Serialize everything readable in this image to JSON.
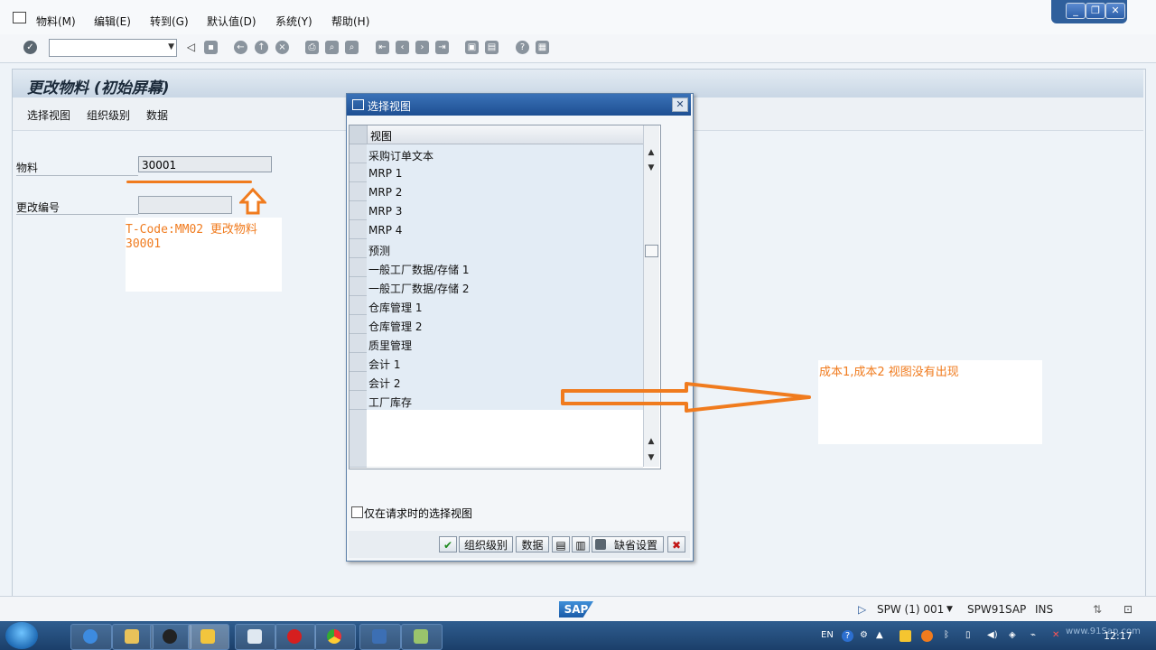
{
  "menu": {
    "items": [
      "物料(M)",
      "编辑(E)",
      "转到(G)",
      "默认值(D)",
      "系统(Y)",
      "帮助(H)"
    ]
  },
  "window_controls": {
    "minimize": "_",
    "restore": "❐",
    "close": "✕"
  },
  "toolbar": {
    "command_field_value": "",
    "icons": [
      "enter-icon",
      "back-arrow-icon",
      "save-icon",
      "back-icon",
      "exit-icon",
      "cancel-icon",
      "print-icon",
      "find-icon",
      "find-next-icon",
      "first-page-icon",
      "prev-page-icon",
      "next-page-icon",
      "last-page-icon",
      "new-session-icon",
      "shortcut-icon",
      "help-icon",
      "layout-icon"
    ]
  },
  "page": {
    "title": "更改物料 (初始屏幕)",
    "app_buttons": [
      "选择视图",
      "组织级别",
      "数据"
    ],
    "material_label": "物料",
    "material_value": "30001",
    "change_number_label": "更改编号",
    "change_number_value": ""
  },
  "annotations": {
    "tcode_line1": "T-Code:MM02 更改物料",
    "tcode_line2": "30001",
    "cost_note": "成本1,成本2 视图没有出现",
    "accent_color": "#f07b1e"
  },
  "dialog": {
    "title": "选择视图",
    "column_header": "视图",
    "rows": [
      "采购订单文本",
      "MRP 1",
      "MRP 2",
      "MRP 3",
      "MRP 4",
      "预测",
      "一般工厂数据/存储 1",
      "一般工厂数据/存储 2",
      "仓库管理 1",
      "仓库管理 2",
      "质里管理",
      "会计 1",
      "会计 2",
      "工厂库存"
    ],
    "checkbox_label": "仅在请求时的选择视图",
    "buttons": {
      "org_levels": "组织级别",
      "data": "数据",
      "default_settings": "缺省设置"
    }
  },
  "status": {
    "logo": "SAP",
    "system": "SPW (1) 001",
    "server": "SPW91SAP",
    "mode": "INS"
  },
  "taskbar": {
    "language": "EN",
    "clock": "12:17",
    "watermark": "www.91Sap.com"
  }
}
